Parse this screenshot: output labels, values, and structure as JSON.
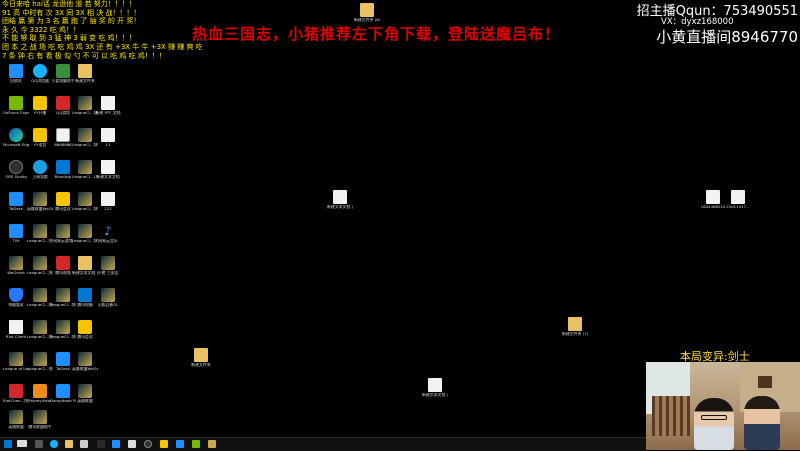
{
  "overlay": {
    "ticker": [
      "今日来哈 hai话 龙逊他 道 若 努力！！！！",
      "91 高 中时有 次 3X 同 3X 相 决 战！！！！",
      "团结 赢 第 为 3 名 赢 跑 了 抽 奖 的 开 奖！",
      "永 久 今 3322 吃 鸡！！",
      "不 能 够 取 到 3 猛 神 3 弱 变 吃 鸡！！！",
      "团 本 之 战 场 吃 吃 鸡 鸡 3X 还 有 +3X 牛 牛 +3X 赚 赚 爽 吃！！！",
      "7 条 钟 右 有 看 极 勾 勺 不 可 以 吃 鸡 吃 鸡！！！"
    ],
    "banner": "热血三国志，小猪推荐左下角下载，登陆送魔吕布！",
    "qq": "招主播Qqun：753490551",
    "wx": "VX：dyxz168000",
    "room": "小黄直播间8946770",
    "caption": "本局变异:剑士"
  },
  "desktop_icons": [
    {
      "label": "回收站",
      "icon": "recycle-bin-icon"
    },
    {
      "label": "QQ浏览器",
      "icon": "qq-browser-icon"
    },
    {
      "label": "小爱电脑助手",
      "icon": "assistant-icon"
    },
    {
      "label": "新建文件夹",
      "icon": "folder-icon"
    },
    {
      "label": "GeForce Experience",
      "icon": "nvidia-icon"
    },
    {
      "label": "YY开播",
      "icon": "yy-icon"
    },
    {
      "label": "QQ游戏",
      "icon": "qq-game-icon"
    },
    {
      "label": "LeagueCl...快捷方式",
      "icon": "league-icon"
    },
    {
      "label": "新建 RTF 文档",
      "icon": "document-icon"
    },
    {
      "label": "Microsoft Edge",
      "icon": "edge-icon"
    },
    {
      "label": "YY语音",
      "icon": "yy-voice-icon"
    },
    {
      "label": "6666666",
      "icon": "keyboard-icon"
    },
    {
      "label": "LeagueCl...快捷方式",
      "icon": "league-icon"
    },
    {
      "label": "11",
      "icon": "document-icon"
    },
    {
      "label": "OBS Studio",
      "icon": "obs-icon"
    },
    {
      "label": "上网导航",
      "icon": "ie-icon"
    },
    {
      "label": "Bandizip",
      "icon": "bandizip-icon"
    },
    {
      "label": "LeagueCl...(33)",
      "icon": "league-icon"
    },
    {
      "label": "新建文本文档",
      "icon": "document-icon"
    },
    {
      "label": "ToDesk",
      "icon": "todesk-icon"
    },
    {
      "label": "英雄联盟WeGame版",
      "icon": "wegame-icon"
    },
    {
      "label": "腾讯会议",
      "icon": "meeting-icon"
    },
    {
      "label": "LeagueCl...快捷方式",
      "icon": "league-icon"
    },
    {
      "label": "222",
      "icon": "document-icon"
    },
    {
      "label": "TIM",
      "icon": "tim-icon"
    },
    {
      "label": "LeagueCl...快捷方式",
      "icon": "league-icon"
    },
    {
      "label": "网易云游戏",
      "icon": "game-icon"
    },
    {
      "label": "LeagueCl...快捷方式",
      "icon": "league-icon"
    },
    {
      "label": "网易云音乐",
      "icon": "music-icon"
    },
    {
      "label": "WeGame",
      "icon": "wegame-icon"
    },
    {
      "label": "LeagueCl...快捷方式",
      "icon": "league-icon"
    },
    {
      "label": "腾讯视频",
      "icon": "tencent-video-icon"
    },
    {
      "label": "新建文本文档 (2)",
      "icon": "folder-icon"
    },
    {
      "label": "小猪 三国志",
      "icon": "game-icon"
    },
    {
      "label": "电脑管家",
      "icon": "shield-icon"
    },
    {
      "label": "LeagueCl...快捷方式",
      "icon": "league-icon"
    },
    {
      "label": "LeagueCl...快捷方式",
      "icon": "league-icon"
    },
    {
      "label": "腾讯电脑",
      "icon": "tencent-icon"
    },
    {
      "label": "火影忍者OL",
      "icon": "game-icon"
    },
    {
      "label": "Riot Client",
      "icon": "document-icon"
    },
    {
      "label": "LeagueCl...快捷方式",
      "icon": "league-icon"
    },
    {
      "label": "LeagueCl...快捷方式",
      "icon": "league-icon"
    },
    {
      "label": "腾讯会议",
      "icon": "meeting-icon"
    },
    {
      "label": "League of Legends",
      "icon": "league-icon"
    },
    {
      "label": "LeagueCl...快捷方式",
      "icon": "league-icon"
    },
    {
      "label": "ToDesk",
      "icon": "todesk-icon"
    },
    {
      "label": "英雄联盟WeGame版",
      "icon": "wegame-icon"
    },
    {
      "label": "RiotClien...快捷方式",
      "icon": "riot-icon"
    },
    {
      "label": "HoneyView",
      "icon": "honeyview-icon"
    },
    {
      "label": "DampNode Pro",
      "icon": "app-icon"
    },
    {
      "label": "英雄联盟",
      "icon": "league-icon"
    },
    {
      "label": "英雄联盟",
      "icon": "league-icon"
    },
    {
      "label": "腾讯联盟助手",
      "icon": "league-icon"
    },
    {
      "label": "新建文件夹",
      "icon": "folder-icon"
    },
    {
      "label": "新建文本文档 (5)",
      "icon": "document-icon"
    },
    {
      "label": "新建文件夹 (7)",
      "icon": "folder-icon"
    },
    {
      "label": "新建文件夹 (6)",
      "icon": "folder-icon"
    },
    {
      "label": "新建文本文档 (4)",
      "icon": "document-icon"
    },
    {
      "label": "1644466224",
      "icon": "document-icon"
    },
    {
      "label": "22d11547...",
      "icon": "document-icon"
    }
  ]
}
